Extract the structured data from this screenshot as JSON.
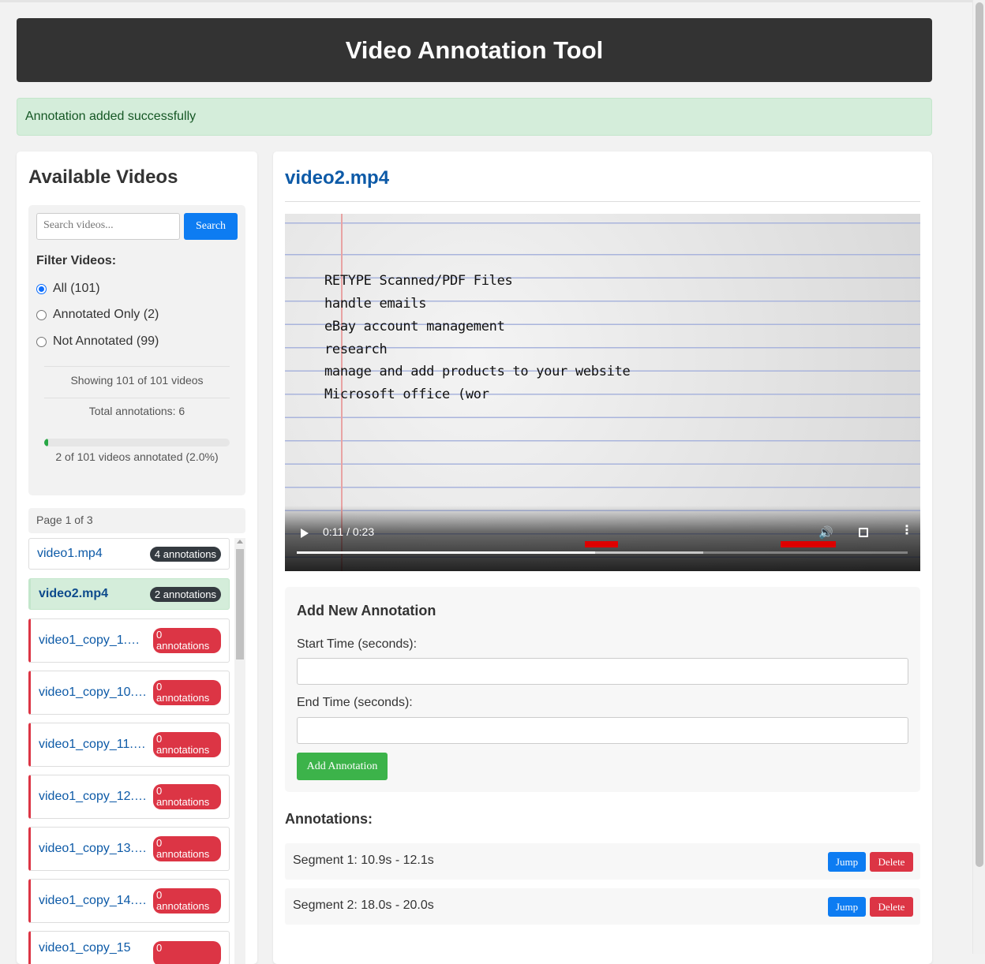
{
  "app": {
    "title": "Video Annotation Tool",
    "alert": "Annotation added successfully"
  },
  "sidebar": {
    "heading": "Available Videos",
    "search": {
      "placeholder": "Search videos...",
      "button_label": "Search"
    },
    "filter": {
      "label": "Filter Videos:",
      "options": [
        {
          "label": "All (101)",
          "checked": true
        },
        {
          "label": "Annotated Only (2)",
          "checked": false
        },
        {
          "label": "Not Annotated (99)",
          "checked": false
        }
      ]
    },
    "stats": {
      "showing": "Showing 101 of 101 videos",
      "total": "Total annotations: 6",
      "progress_fraction": 0.02,
      "progress_text": "2 of 101 videos annotated (2.0%)"
    },
    "page_indicator": "Page 1 of 3",
    "videos": [
      {
        "name": "video1.mp4",
        "badge": "4 annotations"
      },
      {
        "name": "video2.mp4",
        "badge": "2 annotations"
      },
      {
        "name": "video1_copy_1.m…",
        "badge": "0 annotations"
      },
      {
        "name": "video1_copy_10.…",
        "badge": "0 annotations"
      },
      {
        "name": "video1_copy_11.…",
        "badge": "0 annotations"
      },
      {
        "name": "video1_copy_12.…",
        "badge": "0 annotations"
      },
      {
        "name": "video1_copy_13.…",
        "badge": "0 annotations"
      },
      {
        "name": "video1_copy_14.…",
        "badge": "0 annotations"
      },
      {
        "name": "video1_copy_15",
        "badge": "0"
      }
    ]
  },
  "main": {
    "video_title": "video2.mp4",
    "video": {
      "lines": [
        "RETYPE Scanned/PDF Files",
        "handle emails",
        "eBay account management",
        "research",
        "manage and add products to your website",
        "Microsoft office (wor"
      ],
      "time": "0:11 / 0:23",
      "played_fraction": 0.489,
      "buffered_fraction": 0.665
    },
    "add_form": {
      "heading": "Add New Annotation",
      "start_label": "Start Time (seconds):",
      "start_value": "",
      "end_label": "End Time (seconds):",
      "end_value": "",
      "button_label": "Add Annotation"
    },
    "annotations": {
      "heading": "Annotations:",
      "items": [
        {
          "label": "Segment 1: 10.9s - 12.1s",
          "jump": "Jump",
          "delete": "Delete"
        },
        {
          "label": "Segment 2: 18.0s - 20.0s",
          "jump": "Jump",
          "delete": "Delete"
        }
      ]
    }
  },
  "colors": {
    "header_bg": "#333333",
    "accent_blue": "#0d7cf2",
    "success_green": "#28a745",
    "danger_red": "#dc3545"
  }
}
